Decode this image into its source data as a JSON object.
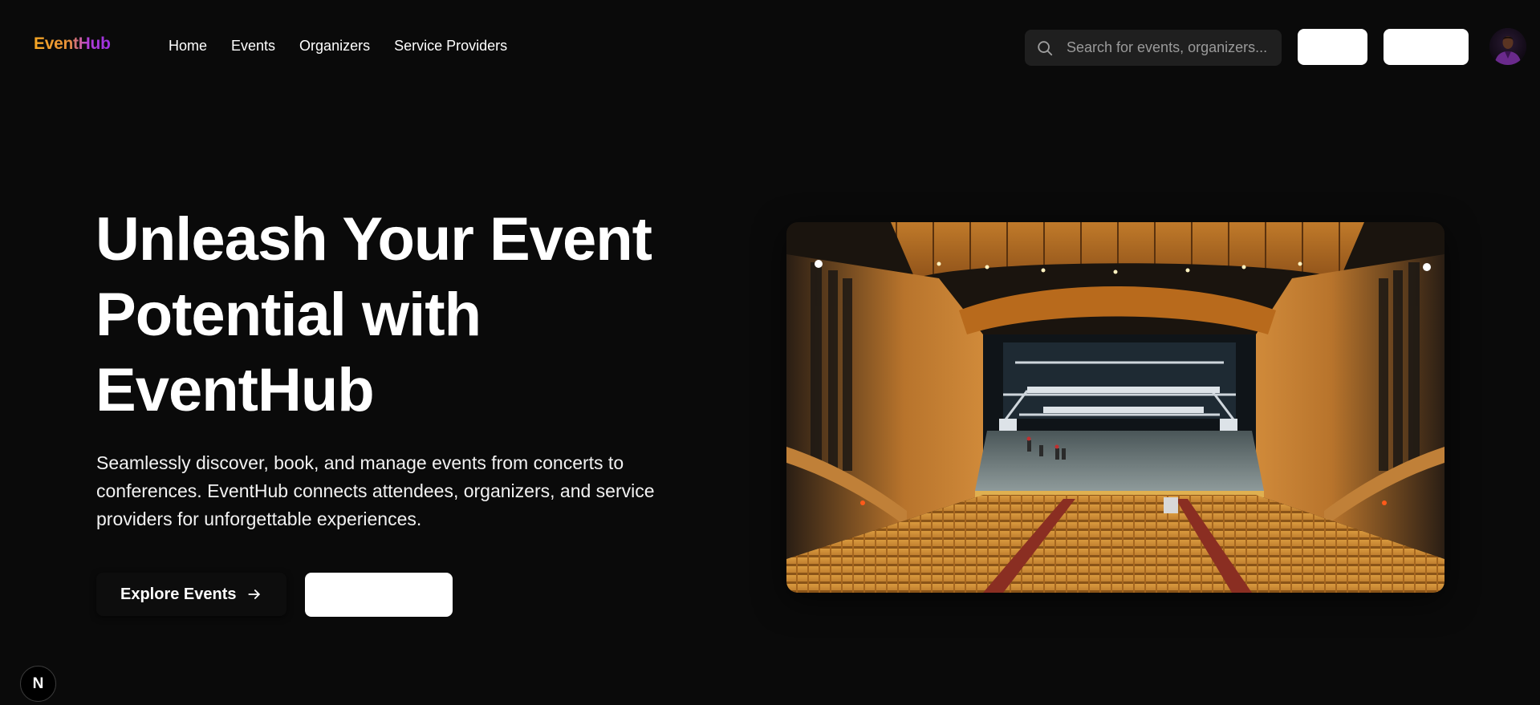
{
  "header": {
    "logo": "EventHub",
    "nav": [
      "Home",
      "Events",
      "Organizers",
      "Service Providers"
    ],
    "search": {
      "placeholder": "Search for events, organizers..."
    },
    "buttons": [
      "",
      ""
    ],
    "avatar": {
      "icon": "user-avatar"
    }
  },
  "hero": {
    "title": "Unleash Your Event Potential with EventHub",
    "description": "Seamlessly discover, book, and manage events from concerts to conferences. EventHub connects attendees, organizers, and service providers for unforgettable experiences.",
    "primary_button": "Explore Events",
    "secondary_button": "",
    "image_icon": "auditorium-stage-photo"
  },
  "dev_badge": {
    "label": "N"
  },
  "colors": {
    "background": "#0a0a0a",
    "logo_gradient_start": "#f5a623",
    "logo_gradient_end": "#9b2fe0",
    "search_bg": "#1f1f1f",
    "button_bg": "#ffffff"
  }
}
